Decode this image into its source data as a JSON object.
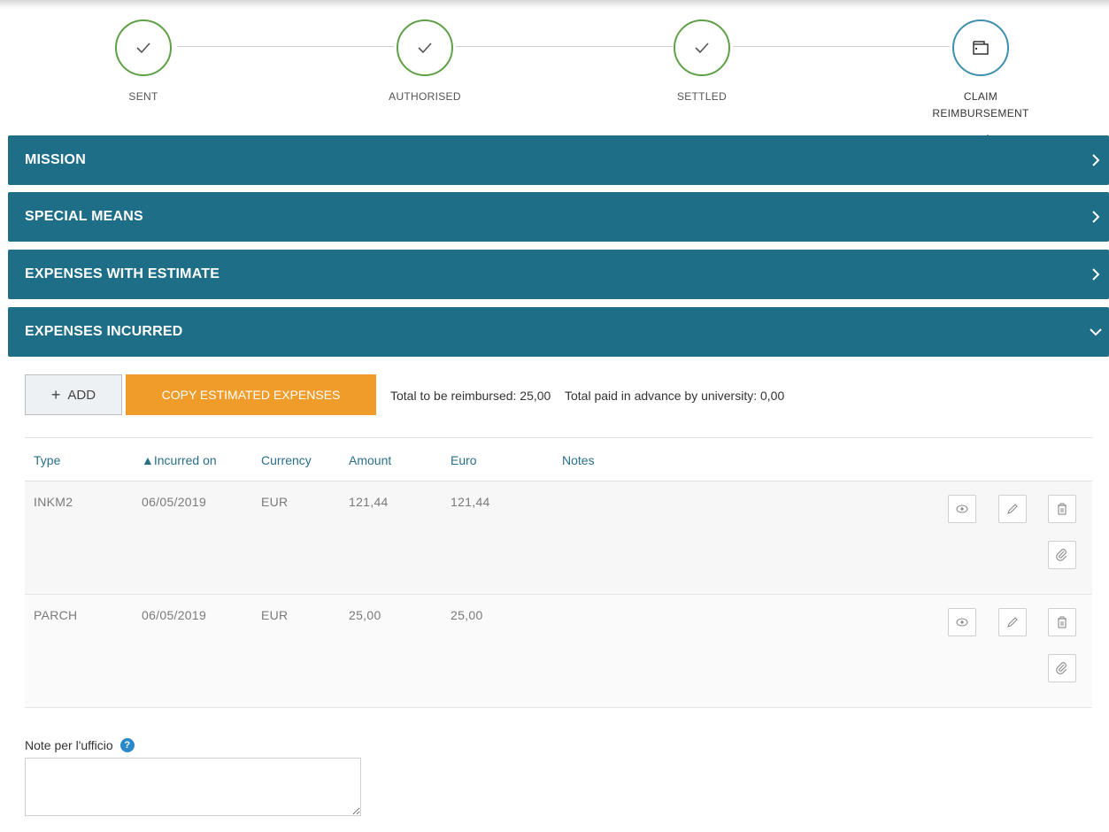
{
  "stepper": {
    "steps": [
      {
        "label": "SENT",
        "status": "done",
        "icon": "check-icon"
      },
      {
        "label": "AUTHORISED",
        "status": "done",
        "icon": "check-icon"
      },
      {
        "label": "SETTLED",
        "status": "done",
        "icon": "check-icon"
      },
      {
        "label": "CLAIM REIMBURSEMENT",
        "status": "current",
        "icon": "wallet-icon"
      }
    ]
  },
  "colors": {
    "panel": "#1e6e88",
    "done": "#5fa046",
    "current": "#3f8fae",
    "copy_button": "#ef9c2a",
    "help": "#2b89c9"
  },
  "panels": [
    {
      "title": "MISSION",
      "expanded": false
    },
    {
      "title": "SPECIAL MEANS",
      "expanded": false
    },
    {
      "title": "EXPENSES WITH ESTIMATE",
      "expanded": false
    },
    {
      "title": "EXPENSES INCURRED",
      "expanded": true
    }
  ],
  "expenses": {
    "add_label": "ADD",
    "copy_label": "COPY ESTIMATED EXPENSES",
    "total_reimbursed": "Total to be reimbursed: 25,00",
    "total_advance": "Total paid in advance by university: 0,00",
    "columns": [
      "Type",
      "▲Incurred on",
      "Currency",
      "Amount",
      "Euro",
      "Notes"
    ],
    "rows": [
      {
        "type": "INKM2",
        "date": "06/05/2019",
        "currency": "EUR",
        "amount": "121,44",
        "euro": "121,44",
        "notes": ""
      },
      {
        "type": "PARCH",
        "date": "06/05/2019",
        "currency": "EUR",
        "amount": "25,00",
        "euro": "25,00",
        "notes": ""
      }
    ]
  },
  "notes": {
    "label": "Note per l'ufficio",
    "help": "?",
    "value": ""
  }
}
